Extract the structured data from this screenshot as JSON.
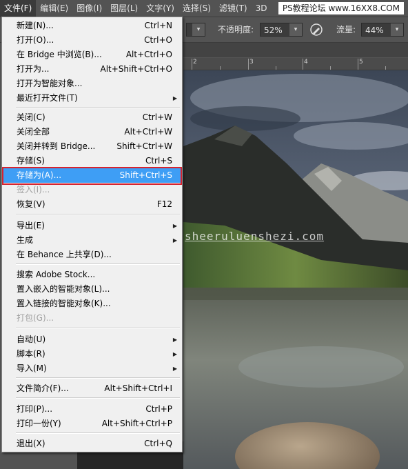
{
  "menubar": {
    "items": [
      "文件(F)",
      "编辑(E)",
      "图像(I)",
      "图层(L)",
      "文字(Y)",
      "选择(S)",
      "滤镜(T)",
      "3D"
    ],
    "watermark": "PS教程论坛 www.16XX8.COM"
  },
  "options": {
    "opacity_label": "不透明度:",
    "opacity_value": "52%",
    "flow_label": "流量:",
    "flow_value": "44%",
    "dropdown_arrow": "▾"
  },
  "ruler": {
    "labels": [
      "2",
      "3",
      "4",
      "5"
    ]
  },
  "canvas": {
    "site_watermark": "sheeruluenshezi.com"
  },
  "file_menu": {
    "items": [
      {
        "label": "新建(N)...",
        "shortcut": "Ctrl+N"
      },
      {
        "label": "打开(O)...",
        "shortcut": "Ctrl+O"
      },
      {
        "label": "在 Bridge 中浏览(B)...",
        "shortcut": "Alt+Ctrl+O"
      },
      {
        "label": "打开为...",
        "shortcut": "Alt+Shift+Ctrl+O"
      },
      {
        "label": "打开为智能对象...",
        "shortcut": ""
      },
      {
        "label": "最近打开文件(T)",
        "shortcut": "",
        "submenu": "▶"
      },
      {
        "label": "关闭(C)",
        "shortcut": "Ctrl+W"
      },
      {
        "label": "关闭全部",
        "shortcut": "Alt+Ctrl+W"
      },
      {
        "label": "关闭并转到 Bridge...",
        "shortcut": "Shift+Ctrl+W"
      },
      {
        "label": "存储(S)",
        "shortcut": "Ctrl+S"
      },
      {
        "label": "存储为(A)...",
        "shortcut": "Shift+Ctrl+S"
      },
      {
        "label": "签入(I)...",
        "shortcut": ""
      },
      {
        "label": "恢复(V)",
        "shortcut": "F12"
      },
      {
        "label": "导出(E)",
        "shortcut": "",
        "submenu": "▶"
      },
      {
        "label": "生成",
        "shortcut": "",
        "submenu": "▶"
      },
      {
        "label": "在 Behance 上共享(D)...",
        "shortcut": ""
      },
      {
        "label": "搜索 Adobe Stock...",
        "shortcut": ""
      },
      {
        "label": "置入嵌入的智能对象(L)...",
        "shortcut": ""
      },
      {
        "label": "置入链接的智能对象(K)...",
        "shortcut": ""
      },
      {
        "label": "打包(G)...",
        "shortcut": ""
      },
      {
        "label": "自动(U)",
        "shortcut": "",
        "submenu": "▶"
      },
      {
        "label": "脚本(R)",
        "shortcut": "",
        "submenu": "▶"
      },
      {
        "label": "导入(M)",
        "shortcut": "",
        "submenu": "▶"
      },
      {
        "label": "文件简介(F)...",
        "shortcut": "Alt+Shift+Ctrl+I"
      },
      {
        "label": "打印(P)...",
        "shortcut": "Ctrl+P"
      },
      {
        "label": "打印一份(Y)",
        "shortcut": "Alt+Shift+Ctrl+P"
      },
      {
        "label": "退出(X)",
        "shortcut": "Ctrl+Q"
      }
    ]
  },
  "colors": {
    "highlight": "#3e9ef5",
    "annotation_box": "#d6232f"
  }
}
